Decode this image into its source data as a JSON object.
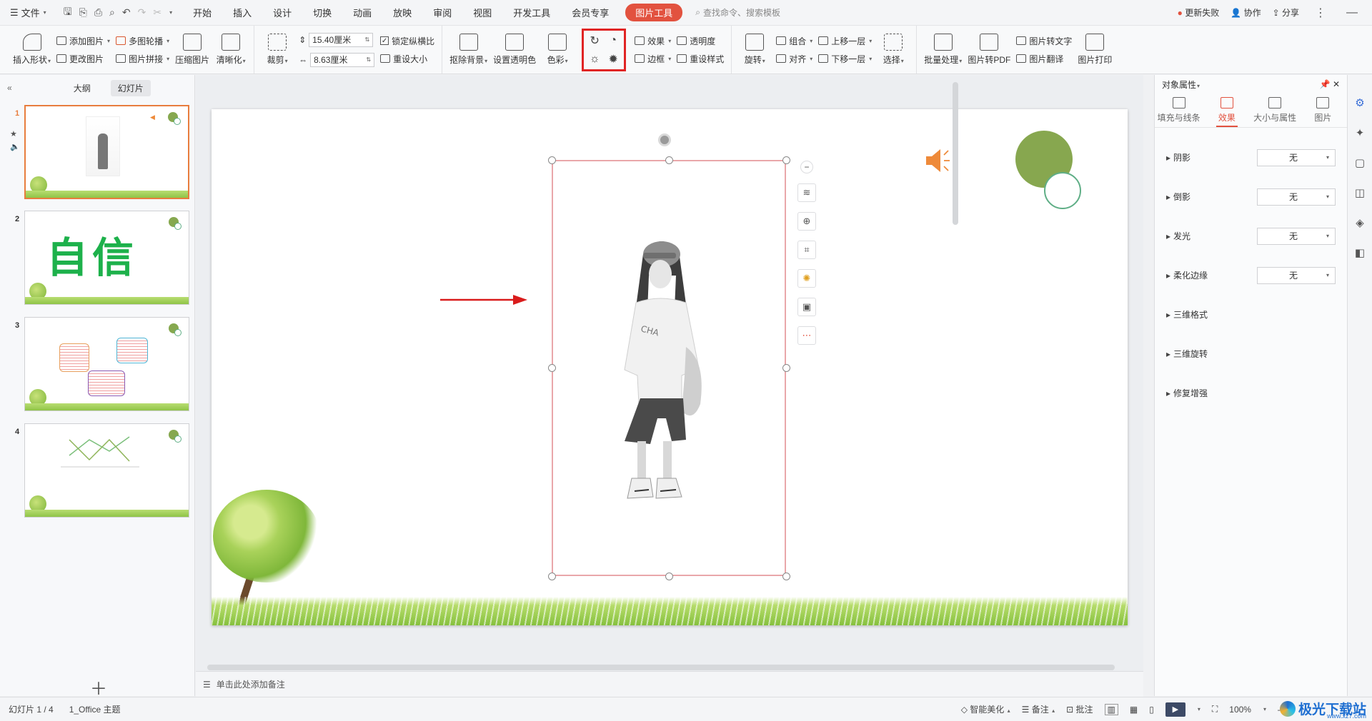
{
  "menubar": {
    "file_label": "文件",
    "menus": [
      "开始",
      "插入",
      "设计",
      "切换",
      "动画",
      "放映",
      "审阅",
      "视图",
      "开发工具",
      "会员专享"
    ],
    "active_tab": "图片工具",
    "search_placeholder": "查找命令、搜索模板",
    "update_failed": "更新失败",
    "collaborate": "协作",
    "share": "分享"
  },
  "ribbon": {
    "insert_shape": "插入形状",
    "add_picture": "添加图片",
    "change_picture": "更改图片",
    "multi_carousel": "多图轮播",
    "picture_mosaic": "图片拼接",
    "compress_picture": "压缩图片",
    "sharpen": "清晰化",
    "crop": "裁剪",
    "width_value": "15.40厘米",
    "height_value": "8.63厘米",
    "lock_ratio": "锁定纵横比",
    "reset_size": "重设大小",
    "remove_background": "抠除背景",
    "set_transparent_color": "设置透明色",
    "color": "色彩",
    "effects": "效果",
    "transparency": "透明度",
    "border": "边框",
    "reset_style": "重设样式",
    "rotate": "旋转",
    "group": "组合",
    "align": "对齐",
    "bring_forward": "上移一层",
    "send_backward": "下移一层",
    "select": "选择",
    "batch_process": "批量处理",
    "picture_to_pdf": "图片转PDF",
    "picture_to_text": "图片转文字",
    "picture_translate": "图片翻译",
    "picture_print": "图片打印"
  },
  "leftpanel": {
    "tab_outline": "大纲",
    "tab_slides": "幻灯片",
    "slides": [
      {
        "num": "1"
      },
      {
        "num": "2",
        "text": "自信"
      },
      {
        "num": "3"
      },
      {
        "num": "4"
      }
    ]
  },
  "notes": {
    "placeholder": "单击此处添加备注"
  },
  "rightpanel": {
    "title": "对象属性",
    "tabs": [
      "填充与线条",
      "效果",
      "大小与属性",
      "图片"
    ],
    "active_tab": "效果",
    "props": [
      {
        "label": "阴影",
        "value": "无"
      },
      {
        "label": "倒影",
        "value": "无"
      },
      {
        "label": "发光",
        "value": "无"
      },
      {
        "label": "柔化边缘",
        "value": "无"
      },
      {
        "label": "三维格式"
      },
      {
        "label": "三维旋转"
      },
      {
        "label": "修复增强"
      }
    ]
  },
  "statusbar": {
    "slide_counter": "幻灯片 1 / 4",
    "theme": "1_Office 主题",
    "smart_beautify": "智能美化",
    "notes": "备注",
    "comments": "批注",
    "zoom": "100%"
  },
  "watermark": {
    "brand": "极光下载站",
    "url": "www.xz7.com"
  },
  "colors": {
    "accent": "#e2523f",
    "highlight": "#e02424",
    "arrow": "#d91c1c",
    "green_circle": "#87a74f",
    "ring": "#5fae86",
    "speaker": "#ee8a3a"
  }
}
